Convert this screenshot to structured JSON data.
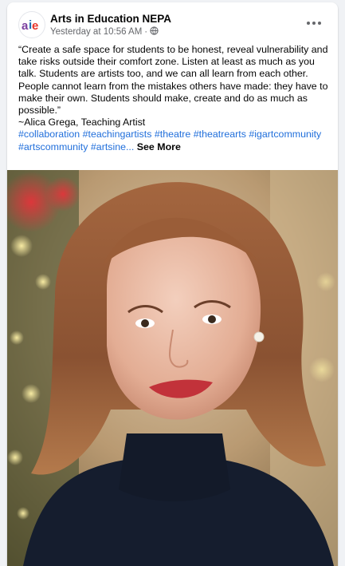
{
  "post": {
    "page_name": "Arts in Education NEPA",
    "timestamp": "Yesterday at 10:56 AM",
    "separator": "·",
    "privacy_icon": "globe-icon",
    "more_icon": "more-horizontal-icon",
    "quote": "“Create a safe space for students to be honest, reveal vulnerability and take risks outside their comfort zone. Listen at least as much as you talk. Students are artists too, and we can all learn from each other. People cannot learn from the mistakes others have made: they have to make their own. Students should make, create and do as much as possible.”",
    "attribution": "~Alica Grega, Teaching Artist",
    "hashtags": [
      "#collaboration",
      "#teachingartists",
      "#theatre",
      "#theatrearts",
      "#igartcommunity",
      "#artscommunity"
    ],
    "truncated_tag": "#artsine...",
    "see_more": "See More"
  },
  "logo": {
    "text_a": "a",
    "text_i": "i",
    "text_e": "e",
    "colors": {
      "a": "#7b3fa0",
      "i": "#1f6fb5",
      "e": "#e8342a"
    }
  },
  "colors": {
    "link": "#216fdb",
    "secondary_text": "#65676b",
    "primary_text": "#050505"
  }
}
